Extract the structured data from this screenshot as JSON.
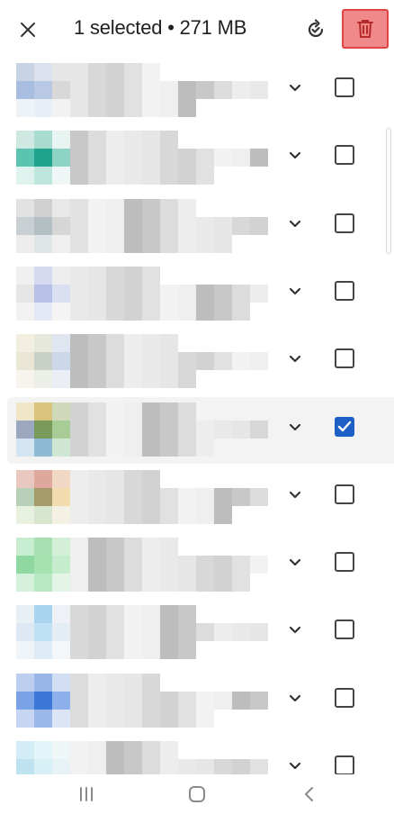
{
  "header": {
    "title": "1 selected • 271 MB",
    "icons": [
      "close-icon",
      "refresh-check-icon",
      "trash-icon"
    ],
    "delete_highlight_color": "#f0898a"
  },
  "rows": [
    {
      "selected": false,
      "thumb": [
        "#c9d3e6",
        "#dbe2ee",
        "#e6e6e6",
        "#a9bde0",
        "#b9c8e4",
        "#d8d8d8",
        "#eef3f8",
        "#e8eef6",
        "#f2f2f2"
      ]
    },
    {
      "selected": false,
      "thumb": [
        "#cfe9e2",
        "#a8dccf",
        "#e8f4f1",
        "#5cc3b0",
        "#1fa38d",
        "#8fd3c4",
        "#dff2ee",
        "#bfe6dc",
        "#eef7f5"
      ]
    },
    {
      "selected": false,
      "thumb": [
        "#e2e2e2",
        "#d0d0d0",
        "#e8e8e8",
        "#c8d0d4",
        "#b4bfc4",
        "#d6d6d6",
        "#ececec",
        "#dfe4e6",
        "#efefef"
      ]
    },
    {
      "selected": false,
      "thumb": [
        "#f0f0f0",
        "#d6daf0",
        "#eeeeee",
        "#e6e6e6",
        "#b8c0e6",
        "#dadff2",
        "#f2f2f2",
        "#e4e7f4",
        "#f4f4f4"
      ]
    },
    {
      "selected": false,
      "thumb": [
        "#f3efe0",
        "#e6e8dc",
        "#dfe6f0",
        "#eae6d6",
        "#c8d0c8",
        "#ccd8ea",
        "#f6f4ec",
        "#eceee8",
        "#ebeff5"
      ]
    },
    {
      "selected": true,
      "thumb": [
        "#f0e6c8",
        "#d9c47e",
        "#cfd8b8",
        "#9ca8bf",
        "#7a9a5a",
        "#a8cc96",
        "#d4e4f0",
        "#8fbad4",
        "#cfe6d2"
      ]
    },
    {
      "selected": false,
      "thumb": [
        "#e8c8c0",
        "#dea89c",
        "#f0d8c4",
        "#b8d0b8",
        "#a69a6a",
        "#f2dcae",
        "#e8f0e0",
        "#d8e6d0",
        "#f4f0e4"
      ]
    },
    {
      "selected": false,
      "thumb": [
        "#c8ecd0",
        "#a8e0b4",
        "#d4efd8",
        "#8fd8a2",
        "#a4e2b0",
        "#c6ecce",
        "#d4f0da",
        "#b8e8c2",
        "#e2f5e6"
      ]
    },
    {
      "selected": false,
      "thumb": [
        "#e8f0f6",
        "#a8d4f0",
        "#eef2f6",
        "#dde8f2",
        "#c0e0f4",
        "#e4edf4",
        "#eef4f8",
        "#dcebf6",
        "#f4f7fa"
      ]
    },
    {
      "selected": false,
      "thumb": [
        "#bccfee",
        "#9ab6e8",
        "#d2def4",
        "#7aa2e6",
        "#3b78d8",
        "#8eb0ea",
        "#c6d6f2",
        "#9cb8ea",
        "#dbe5f6"
      ]
    },
    {
      "selected": false,
      "thumb": [
        "#d4ecf6",
        "#e2f6fa",
        "#eef6f8",
        "#bfe2f0",
        "#d6f0f6",
        "#e6f2f6",
        "#e4f2f8",
        "#eef8fa",
        "#f4f8fa"
      ]
    }
  ],
  "navbar": {
    "icons": [
      "recent-apps-icon",
      "home-icon",
      "back-icon"
    ]
  }
}
